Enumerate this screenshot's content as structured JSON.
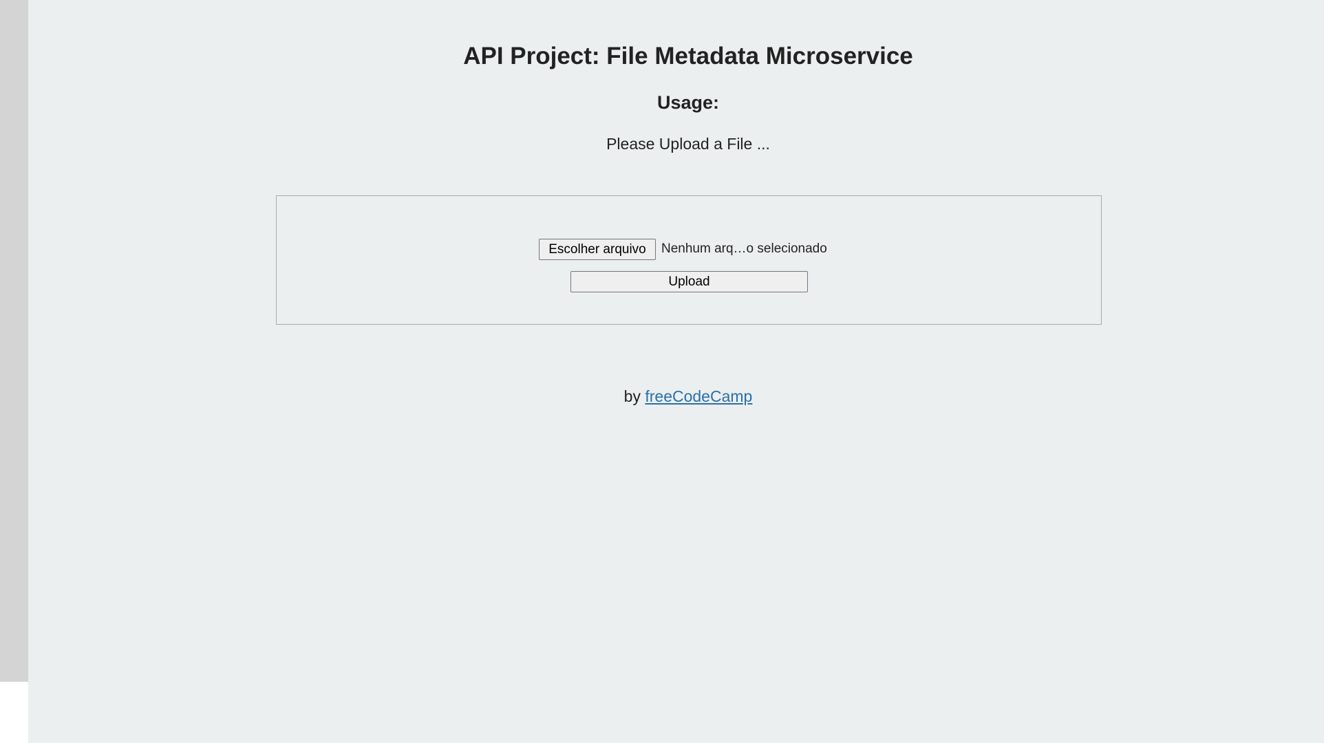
{
  "header": {
    "title": "API Project: File Metadata Microservice",
    "subtitle": "Usage:",
    "instruction": "Please Upload a File ..."
  },
  "form": {
    "choose_file_label": "Escolher arquivo",
    "file_status": "Nenhum arq…o selecionado",
    "upload_label": "Upload"
  },
  "footer": {
    "by_text": "by ",
    "link_text": "freeCodeCamp"
  },
  "colors": {
    "background": "#ebeff0",
    "link": "#2a6fa8",
    "sidebar": "#d4d4d4"
  }
}
